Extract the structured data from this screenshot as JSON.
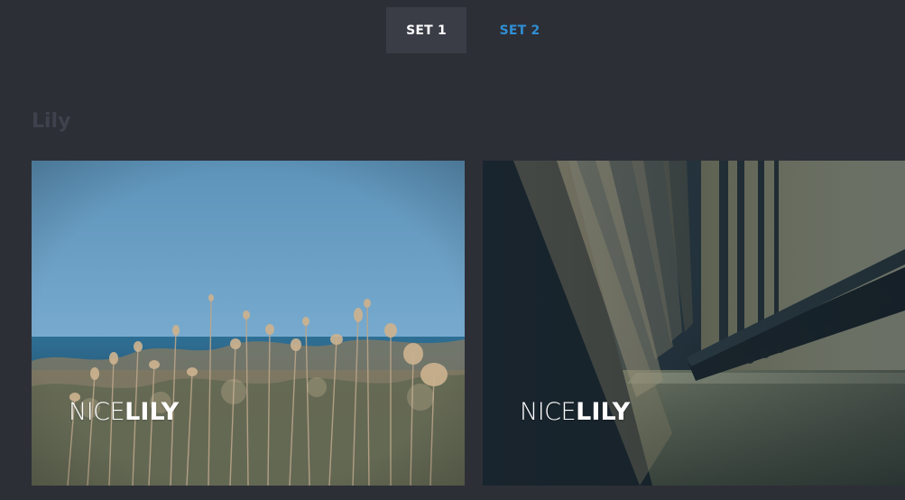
{
  "tabs": [
    {
      "label": "SET 1",
      "active": true
    },
    {
      "label": "SET 2",
      "active": false
    }
  ],
  "section": {
    "title": "Lily"
  },
  "cards": [
    {
      "caption_prefix": "NICE",
      "caption_emphasis": "LILY"
    },
    {
      "caption_prefix": "NICE",
      "caption_emphasis": "LILY"
    }
  ],
  "colors": {
    "background": "#2d2f37",
    "tab_active_bg": "#3a3d46",
    "tab_inactive_text": "#2f8fd4",
    "section_title": "#3f424c"
  }
}
